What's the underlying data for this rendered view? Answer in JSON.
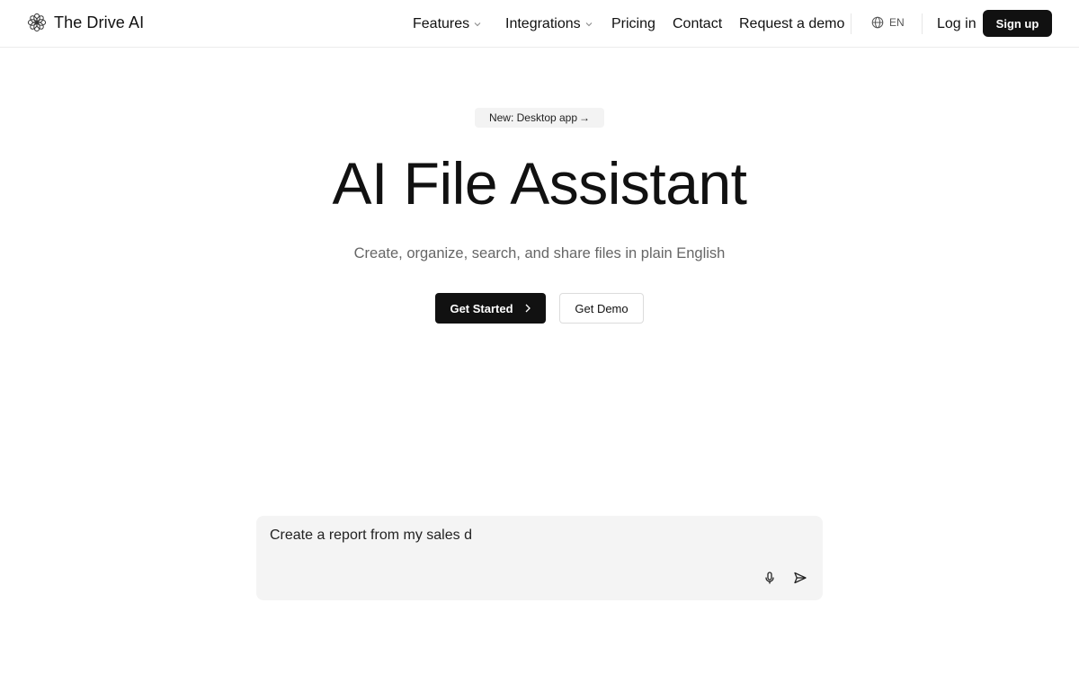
{
  "brand": {
    "name": "The Drive AI",
    "logo_icon": "flower-logo-icon"
  },
  "nav": {
    "features": "Features",
    "integrations": "Integrations",
    "pricing": "Pricing",
    "contact": "Contact",
    "request_demo": "Request a demo",
    "language": "EN",
    "login": "Log in",
    "signup": "Sign up"
  },
  "hero": {
    "badge": "New: Desktop app",
    "badge_arrow": "→",
    "title": "AI File Assistant",
    "subtitle": "Create, organize, search, and share files in plain English",
    "primary_button": "Get Started",
    "secondary_button": "Get Demo"
  },
  "prompt": {
    "value": "Create a report from my sales d"
  },
  "colors": {
    "primary": "#111111",
    "muted_text": "#666666",
    "prompt_bg": "#f4f4f4",
    "badge_bg": "#f3f3f3"
  }
}
